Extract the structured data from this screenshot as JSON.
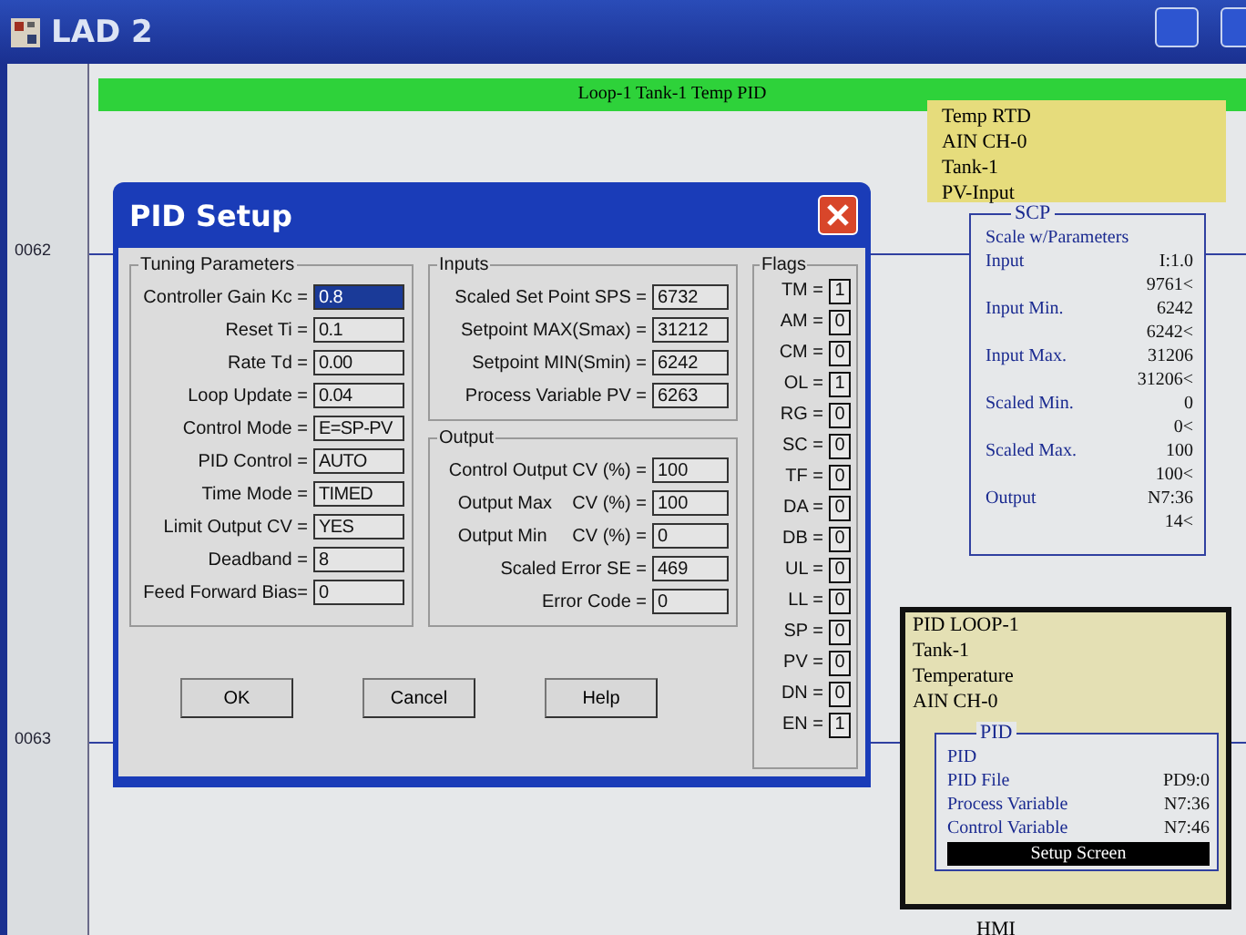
{
  "window": {
    "title": "LAD 2"
  },
  "ladder": {
    "rungs": [
      "0062",
      "0063"
    ],
    "rung_title": "Loop-1 Tank-1 Temp PID",
    "scp_note": [
      "Temp RTD",
      "AIN CH-0",
      "Tank-1",
      "PV-Input"
    ],
    "scp": {
      "title": "SCP",
      "subtitle": "Scale w/Parameters",
      "rows": [
        {
          "label": "Input",
          "address": "I:1.0",
          "value": "9761<"
        },
        {
          "label": "Input Min.",
          "address": "6242",
          "value": "6242<"
        },
        {
          "label": "Input Max.",
          "address": "31206",
          "value": "31206<"
        },
        {
          "label": "Scaled Min.",
          "address": "0",
          "value": "0<"
        },
        {
          "label": "Scaled Max.",
          "address": "100",
          "value": "100<"
        },
        {
          "label": "Output",
          "address": "N7:36",
          "value": "14<"
        }
      ]
    },
    "pid_note": [
      "PID LOOP-1",
      "Tank-1",
      "Temperature",
      "AIN CH-0"
    ],
    "pid": {
      "title": "PID",
      "subtitle": "PID",
      "rows": [
        {
          "label": "PID File",
          "value": "PD9:0"
        },
        {
          "label": "Process Variable",
          "value": "N7:36"
        },
        {
          "label": "Control Variable",
          "value": "N7:46"
        }
      ],
      "button": "Setup Screen"
    },
    "footer_text": "HMI"
  },
  "dialog": {
    "title": "PID Setup",
    "tuning": {
      "title": "Tuning Parameters",
      "fields": [
        {
          "label": "Controller Gain Kc =",
          "value": "0.8",
          "selected": true
        },
        {
          "label": "Reset Ti =",
          "value": "0.1",
          "selected": false
        },
        {
          "label": "Rate Td =",
          "value": "0.00",
          "selected": false
        },
        {
          "label": "Loop Update =",
          "value": "0.04",
          "selected": false
        },
        {
          "label": "Control Mode =",
          "value": "E=SP-PV",
          "selected": false
        },
        {
          "label": "PID Control =",
          "value": "AUTO",
          "selected": false
        },
        {
          "label": "Time Mode =",
          "value": "TIMED",
          "selected": false
        },
        {
          "label": "Limit Output CV =",
          "value": "YES",
          "selected": false
        },
        {
          "label": "Deadband =",
          "value": "8",
          "selected": false
        },
        {
          "label": "Feed Forward Bias=",
          "value": "0",
          "selected": false
        }
      ]
    },
    "inputs": {
      "title": "Inputs",
      "fields": [
        {
          "label": "Scaled Set Point SPS =",
          "value": "6732"
        },
        {
          "label": "Setpoint MAX(Smax) =",
          "value": "31212"
        },
        {
          "label": "Setpoint MIN(Smin) =",
          "value": "6242"
        },
        {
          "label": "Process Variable PV =",
          "value": "6263"
        }
      ]
    },
    "output": {
      "title": "Output",
      "fields": [
        {
          "label": "Control Output CV (%) =",
          "value": "100"
        },
        {
          "label": "Output Max    CV (%) =",
          "value": "100"
        },
        {
          "label": "Output Min     CV (%) =",
          "value": "0"
        },
        {
          "label": "Scaled Error SE =",
          "value": "469"
        },
        {
          "label": "Error Code =",
          "value": "0"
        }
      ]
    },
    "flags": {
      "title": "Flags",
      "items": [
        {
          "label": "TM =",
          "value": "1"
        },
        {
          "label": "AM =",
          "value": "0"
        },
        {
          "label": "CM =",
          "value": "0"
        },
        {
          "label": "OL =",
          "value": "1"
        },
        {
          "label": "RG =",
          "value": "0"
        },
        {
          "label": "SC =",
          "value": "0"
        },
        {
          "label": "TF =",
          "value": "0"
        },
        {
          "label": "DA =",
          "value": "0"
        },
        {
          "label": "DB =",
          "value": "0"
        },
        {
          "label": "UL =",
          "value": "0"
        },
        {
          "label": "LL =",
          "value": "0"
        },
        {
          "label": "SP =",
          "value": "0"
        },
        {
          "label": "PV =",
          "value": "0"
        },
        {
          "label": "DN =",
          "value": "0"
        },
        {
          "label": "EN =",
          "value": "1"
        }
      ]
    },
    "buttons": [
      "OK",
      "Cancel",
      "Help"
    ]
  }
}
